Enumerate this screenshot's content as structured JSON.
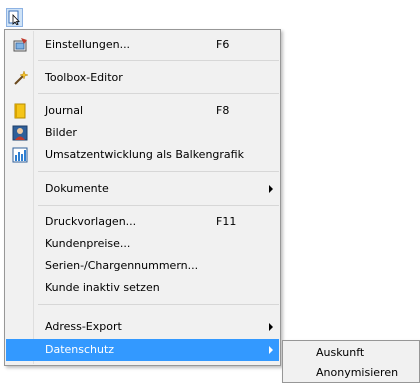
{
  "toolbar": {
    "button_icon": "menu-cursor-icon"
  },
  "menu": {
    "items": [
      {
        "label": "Einstellungen...",
        "shortcut": "F6",
        "icon": "settings-icon"
      },
      {
        "label": "Toolbox-Editor",
        "icon": "magic-wand-icon"
      },
      {
        "label": "Journal",
        "shortcut": "F8",
        "icon": "journal-icon"
      },
      {
        "label": "Bilder",
        "icon": "picture-icon"
      },
      {
        "label": "Umsatzentwicklung als Balkengrafik",
        "icon": "bar-chart-icon"
      },
      {
        "label": "Dokumente",
        "submenu": true
      },
      {
        "label": "Druckvorlagen...",
        "shortcut": "F11"
      },
      {
        "label": "Kundenpreise..."
      },
      {
        "label": "Serien-/Chargennummern..."
      },
      {
        "label": "Kunde inaktiv setzen"
      },
      {
        "label": "Adress-Export",
        "submenu": true
      },
      {
        "label": "Datenschutz",
        "submenu": true,
        "highlighted": true
      }
    ]
  },
  "submenu": {
    "items": [
      {
        "label": "Auskunft"
      },
      {
        "label": "Anonymisieren"
      }
    ]
  },
  "colors": {
    "highlight": "#3399ff",
    "menu_bg": "#f1f1f1",
    "border": "#979797"
  }
}
